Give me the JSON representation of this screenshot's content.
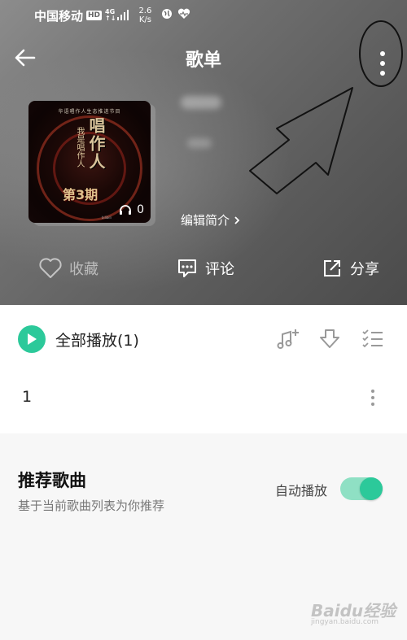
{
  "status_bar": {
    "carrier": "中国移动",
    "hd_badge": "HD",
    "network_top": "4G",
    "network_bottom": "↑↓",
    "speed_value": "2.6",
    "speed_unit": "K/s"
  },
  "header": {
    "title": "歌单"
  },
  "cover": {
    "top_text": "华语唱作人生态推进节目",
    "title_vertical": "唱作人",
    "subtitle_vertical": "我是唱作人",
    "issue": "第3期",
    "play_count": "0",
    "footer_text": "bilibili"
  },
  "playlist": {
    "edit_intro": "编辑简介"
  },
  "actions": [
    {
      "label": "收藏",
      "icon": "heart-icon"
    },
    {
      "label": "评论",
      "icon": "comment-icon"
    },
    {
      "label": "分享",
      "icon": "share-icon"
    }
  ],
  "track_list": {
    "play_all": "全部播放(1)",
    "song_index": "1"
  },
  "recommend": {
    "title": "推荐歌曲",
    "description": "基于当前歌曲列表为你推荐",
    "autoplay_label": "自动播放",
    "autoplay_on": true
  },
  "watermark": {
    "brand": "Baidu经验",
    "url": "jingyan.baidu.com"
  },
  "colors": {
    "accent": "#2cc99a",
    "toggle_track": "#8fe0c4",
    "annotation": "#111111"
  }
}
